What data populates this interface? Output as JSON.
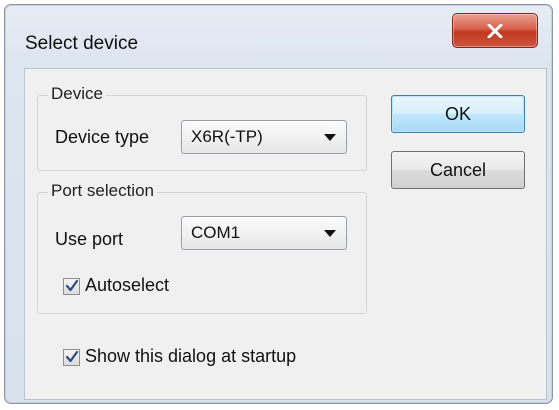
{
  "window": {
    "title": "Select device"
  },
  "device_group": {
    "label": "Device",
    "device_type_label": "Device type",
    "device_type_value": "X6R(-TP)"
  },
  "port_group": {
    "label": "Port selection",
    "use_port_label": "Use port",
    "use_port_value": "COM1",
    "autoselect_label": "Autoselect",
    "autoselect_checked": true
  },
  "startup": {
    "label": "Show this dialog at startup",
    "checked": true
  },
  "buttons": {
    "ok": "OK",
    "cancel": "Cancel"
  },
  "icons": {
    "close": "close-icon",
    "checkmark": "checkmark-icon",
    "dropdown": "chevron-down-icon"
  },
  "colors": {
    "close_button": "#c0381f",
    "default_button_border": "#3c7fb1"
  }
}
